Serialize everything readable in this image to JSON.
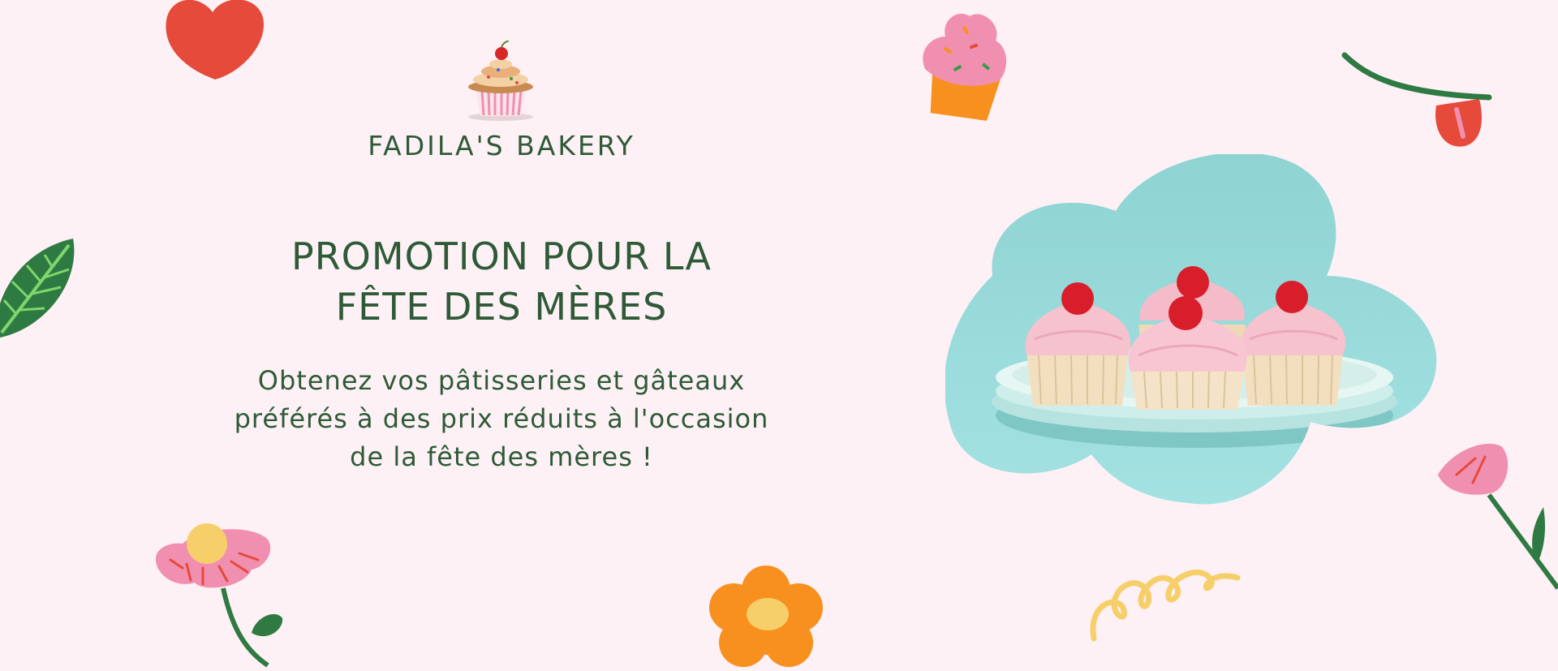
{
  "brand": {
    "name": "FADILA'S BAKERY",
    "logo_icon": "cupcake-logo-icon"
  },
  "headline": {
    "line1": "PROMOTION POUR LA",
    "line2": "FÊTE DES MÈRES"
  },
  "subtext": {
    "line1": "Obtenez vos pâtisseries et gâteaux",
    "line2": "préférés à des prix réduits à l'occasion",
    "line3": "de la fête des mères !"
  },
  "hero_image": {
    "subject": "cupcakes-on-plate-photo",
    "frame_shape": "cloud-flower"
  },
  "decorations": [
    "heart-icon",
    "leaf-icon",
    "cupcake-sticker-icon",
    "tulip-icon",
    "pink-flower-icon",
    "orange-flower-icon",
    "yellow-squiggle-icon",
    "pink-tulip-icon"
  ],
  "colors": {
    "background": "#fdf1f5",
    "text_green": "#2e5a37",
    "accent_red": "#e64a3b",
    "accent_orange": "#f7901e",
    "accent_pink": "#f08fb0",
    "accent_teal": "#8fd8d8",
    "accent_yellow": "#f7cf6a"
  }
}
